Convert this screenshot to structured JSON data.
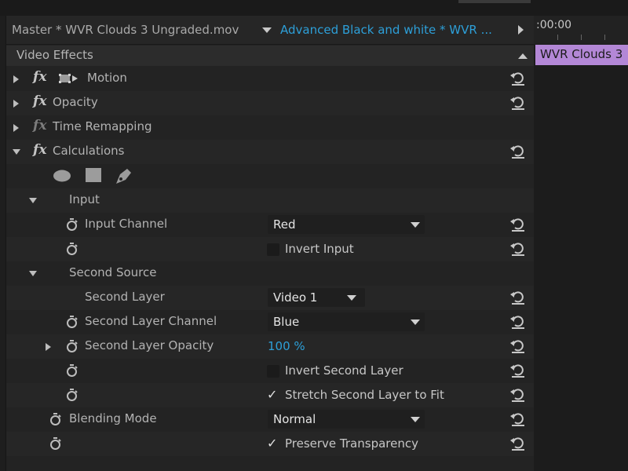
{
  "header": {
    "master_label": "Master * WVR Clouds 3 Ungraded.mov",
    "sequence_label": "Advanced Black and white * WVR ..."
  },
  "video_effects": {
    "title": "Video Effects",
    "effects": [
      {
        "name": "Motion",
        "expanded": false
      },
      {
        "name": "Opacity",
        "expanded": false
      },
      {
        "name": "Time Remapping",
        "expanded": false
      },
      {
        "name": "Calculations",
        "expanded": true
      }
    ],
    "mask_tools": [
      "ellipse-mask-icon",
      "rectangle-mask-icon",
      "pen-mask-icon"
    ]
  },
  "calculations": {
    "input_group": "Input",
    "input_channel_label": "Input Channel",
    "input_channel_value": "Red",
    "invert_input_label": "Invert Input",
    "invert_input_checked": false,
    "second_source_group": "Second Source",
    "second_layer_label": "Second Layer",
    "second_layer_value": "Video 1",
    "second_layer_channel_label": "Second Layer Channel",
    "second_layer_channel_value": "Blue",
    "second_layer_opacity_label": "Second Layer Opacity",
    "second_layer_opacity_value": "100 %",
    "invert_second_layer_label": "Invert Second Layer",
    "invert_second_layer_checked": false,
    "stretch_label": "Stretch Second Layer to Fit",
    "stretch_checked": true,
    "blending_mode_label": "Blending Mode",
    "blending_mode_value": "Normal",
    "preserve_label": "Preserve Transparency",
    "preserve_checked": true
  },
  "timeline": {
    "timecode": ":00:00",
    "clip_label": "WVR Clouds 3"
  },
  "colors": {
    "accent_blue": "#2d9fd8",
    "clip_purple": "#b387d6",
    "panel_bg": "#232323"
  }
}
